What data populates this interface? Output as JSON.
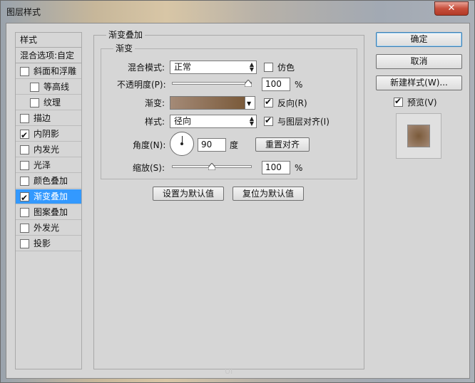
{
  "window": {
    "title": "图层样式",
    "close_glyph": "✕"
  },
  "left_panel": {
    "header": "样式",
    "blend_options": "混合选项:自定",
    "items": [
      {
        "label": "斜面和浮雕",
        "checked": false,
        "sub": false
      },
      {
        "label": "等高线",
        "checked": false,
        "sub": true
      },
      {
        "label": "纹理",
        "checked": false,
        "sub": true
      },
      {
        "label": "描边",
        "checked": false,
        "sub": false
      },
      {
        "label": "内阴影",
        "checked": true,
        "sub": false
      },
      {
        "label": "内发光",
        "checked": false,
        "sub": false
      },
      {
        "label": "光泽",
        "checked": false,
        "sub": false
      },
      {
        "label": "颜色叠加",
        "checked": false,
        "sub": false
      },
      {
        "label": "渐变叠加",
        "checked": true,
        "sub": false,
        "selected": true
      },
      {
        "label": "图案叠加",
        "checked": false,
        "sub": false
      },
      {
        "label": "外发光",
        "checked": false,
        "sub": false
      },
      {
        "label": "投影",
        "checked": false,
        "sub": false
      }
    ]
  },
  "gradient_overlay": {
    "group_title": "渐变叠加",
    "sub_group_title": "渐变",
    "blend_mode_label": "混合模式:",
    "blend_mode_value": "正常",
    "dither_label": "仿色",
    "dither_checked": false,
    "opacity_label": "不透明度(P):",
    "opacity_value": "100",
    "opacity_unit": "%",
    "opacity_fraction": 1.0,
    "gradient_label": "渐变:",
    "gradient_colors": [
      "#a48a77",
      "#7a5a3a"
    ],
    "reverse_label": "反向(R)",
    "reverse_checked": true,
    "style_label": "样式:",
    "style_value": "径向",
    "align_label": "与图层对齐(I)",
    "align_checked": true,
    "angle_label": "角度(N):",
    "angle_value": "90",
    "angle_unit": "度",
    "reset_align_label": "重置对齐",
    "scale_label": "缩放(S):",
    "scale_value": "100",
    "scale_unit": "%",
    "scale_fraction": 0.5,
    "set_default_label": "设置为默认值",
    "reset_default_label": "复位为默认值"
  },
  "right_panel": {
    "ok_label": "确定",
    "cancel_label": "取消",
    "new_style_label": "新建样式(W)...",
    "preview_label": "预览(V)",
    "preview_checked": true,
    "preview_color": "#7a5a3a"
  },
  "colors": {
    "selection": "#3399ff",
    "dialog_bg": "#d6d6d6"
  }
}
